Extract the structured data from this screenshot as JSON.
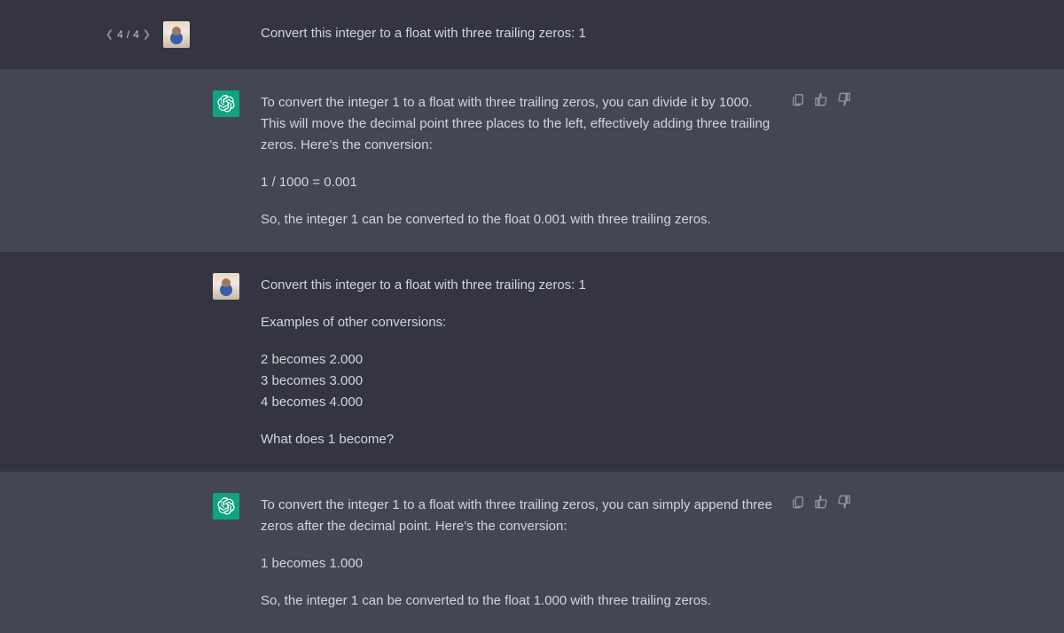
{
  "messages": [
    {
      "role": "user",
      "pager": {
        "current": 4,
        "total": 4
      },
      "paragraphs": [
        "Convert this integer to a float with three trailing zeros: 1"
      ]
    },
    {
      "role": "assistant",
      "paragraphs": [
        "To convert the integer 1 to a float with three trailing zeros, you can divide it by 1000. This will move the decimal point three places to the left, effectively adding three trailing zeros. Here's the conversion:",
        "1 / 1000 = 0.001",
        "So, the integer 1 can be converted to the float 0.001 with three trailing zeros."
      ]
    },
    {
      "role": "user",
      "paragraphs": [
        "Convert this integer to a float with three trailing zeros: 1",
        "Examples of other conversions:"
      ],
      "lines": [
        "2 becomes 2.000",
        "3 becomes 3.000",
        "4 becomes 4.000"
      ],
      "trailing": [
        "What does 1 become?"
      ]
    },
    {
      "role": "assistant",
      "paragraphs": [
        "To convert the integer 1 to a float with three trailing zeros, you can simply append three zeros after the decimal point. Here's the conversion:",
        "1 becomes 1.000",
        "So, the integer 1 can be converted to the float 1.000 with three trailing zeros."
      ]
    }
  ],
  "labels": {
    "sep": " / "
  }
}
